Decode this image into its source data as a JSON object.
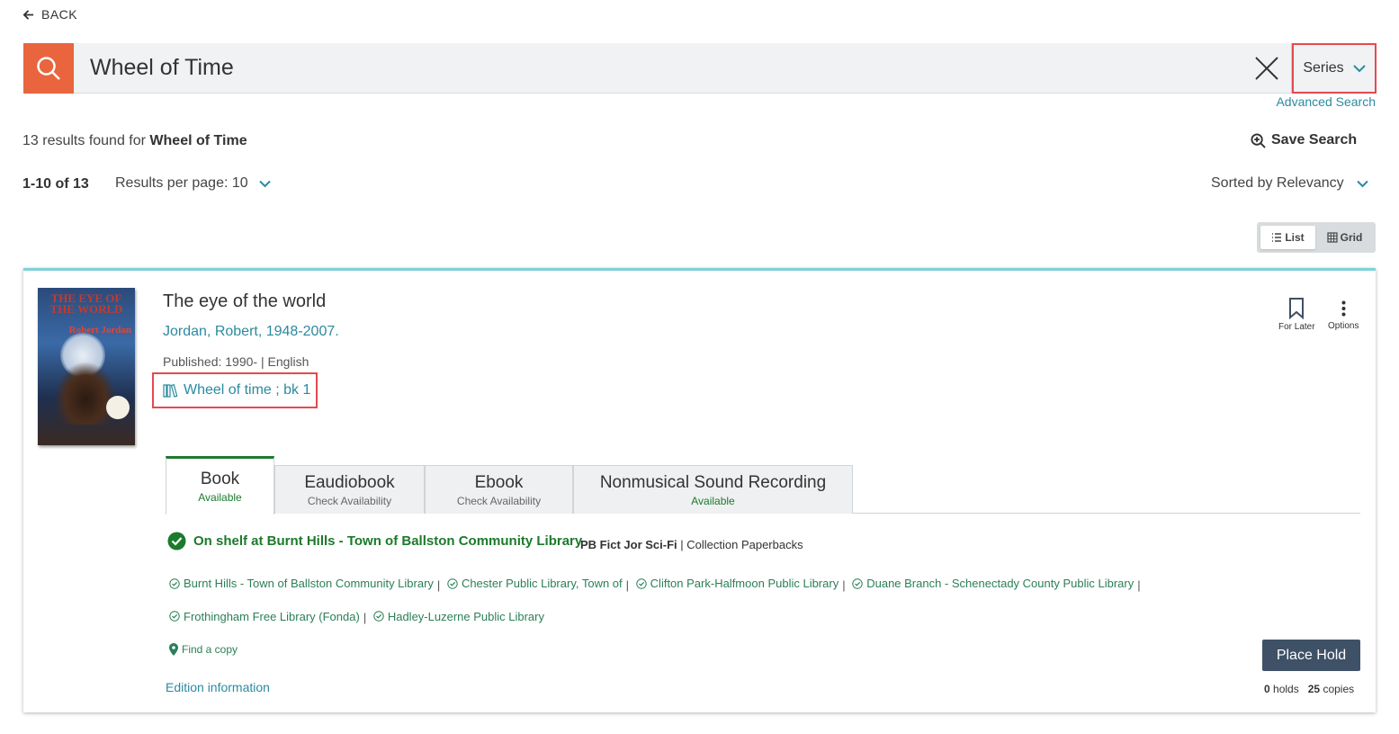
{
  "nav": {
    "back_label": "BACK"
  },
  "search": {
    "query": "Wheel of Time",
    "scope": "Series",
    "advanced_label": "Advanced Search"
  },
  "results": {
    "count_prefix": "13 results found for",
    "count_term": "Wheel of Time",
    "save_search_label": "Save Search",
    "range": "1-10 of 13",
    "per_page_label": "Results per page: 10",
    "sort_label": "Sorted by Relevancy",
    "view_list": "List",
    "view_grid": "Grid"
  },
  "item": {
    "cover": {
      "title": "THE EYE OF THE WORLD",
      "author": "Robert Jordan"
    },
    "title": "The eye of the world",
    "author": "Jordan, Robert, 1948-2007.",
    "published": "Published: 1990- | English",
    "series": "Wheel of time ; bk 1",
    "for_later_label": "For Later",
    "options_label": "Options",
    "formats": [
      {
        "label": "Book",
        "status": "Available"
      },
      {
        "label": "Eaudiobook",
        "status": "Check Availability"
      },
      {
        "label": "Ebook",
        "status": "Check Availability"
      },
      {
        "label": "Nonmusical Sound Recording",
        "status": "Available"
      }
    ],
    "shelf_status": "On shelf at Burnt Hills - Town of Ballston Community Library",
    "call_number": "PB Fict Jor Sci-Fi",
    "collection": "Collection Paperbacks",
    "libraries": [
      "Burnt Hills - Town of Ballston Community Library",
      "Chester Public Library, Town of",
      "Clifton Park-Halfmoon Public Library",
      "Duane Branch - Schenectady County Public Library",
      "Frothingham Free Library (Fonda)",
      "Hadley-Luzerne Public Library"
    ],
    "find_copy_label": "Find a copy",
    "edition_label": "Edition information",
    "place_hold_label": "Place Hold",
    "holds": "0",
    "holds_label": "holds",
    "copies": "25",
    "copies_label": "copies"
  },
  "colors": {
    "search_accent": "#e8653e",
    "link": "#2b8aa0",
    "available": "#1c7a2c",
    "highlight_box": "#e34a50",
    "card_top": "#7ed1d9",
    "button": "#3e5166"
  }
}
